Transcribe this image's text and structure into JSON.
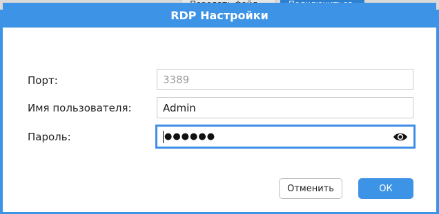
{
  "background_tabs": {
    "send_file": "Передать файл",
    "connect": "Подключиться"
  },
  "dialog": {
    "title": "RDP Настройки",
    "port_label": "Порт:",
    "port_placeholder": "3389",
    "username_label": "Имя пользователя:",
    "username_value": "Admin",
    "password_label": "Пароль:",
    "password_masked": "●●●●●●",
    "cancel_label": "Отменить",
    "ok_label": "ОК"
  },
  "icons": {
    "password_toggle": "eye-icon"
  },
  "colors": {
    "accent": "#3d93e6",
    "focus_border": "#3d8ee6"
  }
}
